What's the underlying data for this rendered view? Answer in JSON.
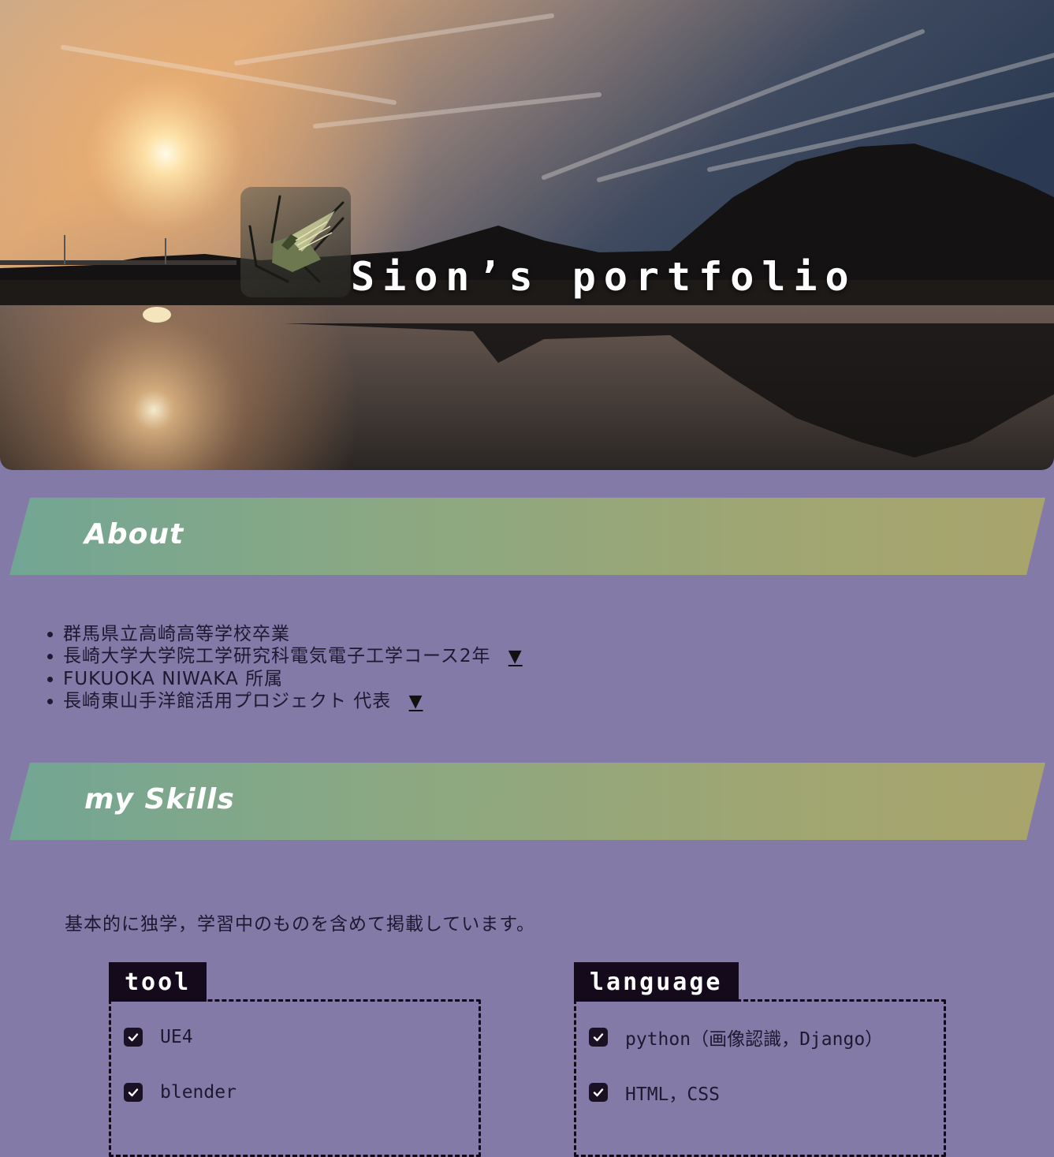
{
  "header": {
    "site_title": "Sion’s portfolio",
    "logo_icon": "origami-crane-logo-icon"
  },
  "about": {
    "heading": "About",
    "items": [
      {
        "text": "群馬県立高崎高等学校卒業",
        "expandable": false
      },
      {
        "text": "長崎大学大学院工学研究科電気電子工学コース2年",
        "expandable": true,
        "toggle": "▼"
      },
      {
        "text": "FUKUOKA NIWAKA 所属",
        "expandable": false
      },
      {
        "text": "長崎東山手洋館活用プロジェクト 代表",
        "expandable": true,
        "toggle": "▼"
      }
    ]
  },
  "skills": {
    "heading": "my Skills",
    "note": "基本的に独学，学習中のものを含めて掲載しています。",
    "groups": [
      {
        "title": "tool",
        "items": [
          "UE4",
          "blender"
        ]
      },
      {
        "title": "language",
        "items": [
          "python（画像認識，Django）",
          "HTML，CSS"
        ]
      }
    ]
  },
  "colors": {
    "page_background": "#847aa8",
    "band_start": "#72a694",
    "band_end": "#a9a46c",
    "tab_background": "#140a1c",
    "checkbox": "#1a1224"
  }
}
